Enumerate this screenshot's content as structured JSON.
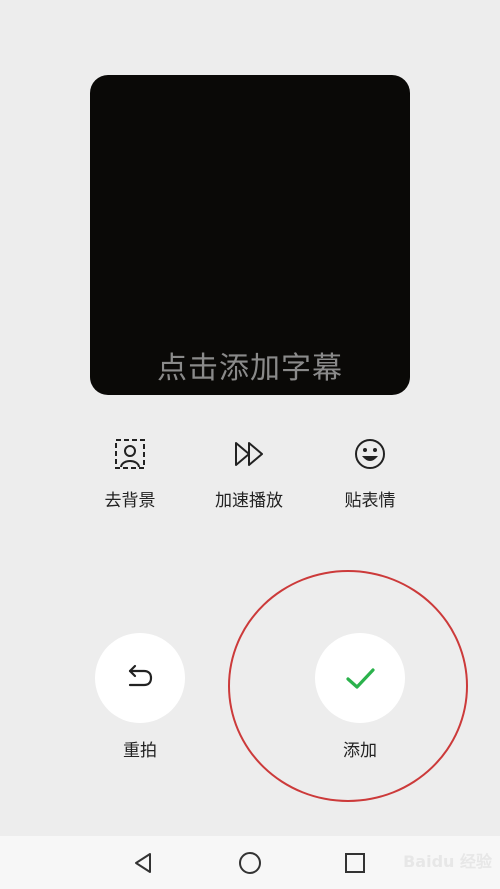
{
  "preview": {
    "caption_placeholder": "点击添加字幕"
  },
  "tools": [
    {
      "label": "去背景",
      "icon": "portrait-frame-icon"
    },
    {
      "label": "加速播放",
      "icon": "fast-forward-icon"
    },
    {
      "label": "贴表情",
      "icon": "smiley-icon"
    }
  ],
  "actions": {
    "retake_label": "重拍",
    "add_label": "添加",
    "accent_color": "#2bb24c"
  },
  "navbar": {
    "back": "back-icon",
    "home": "home-icon",
    "recents": "recents-icon"
  },
  "watermark": "Baidu 经验"
}
